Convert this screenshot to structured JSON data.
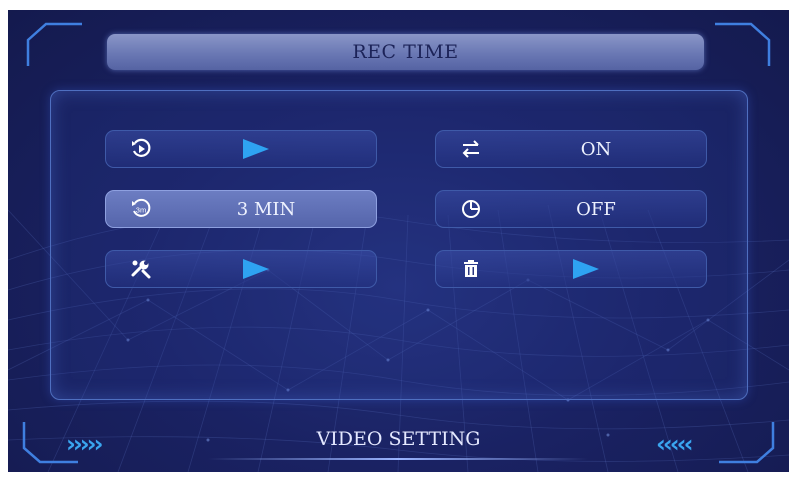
{
  "screen": {
    "title": "REC TIME",
    "footer": "VIDEO SETTING",
    "left_arrows": "›››››",
    "right_arrows": "‹‹‹‹‹"
  },
  "menu": {
    "playback": {
      "icon": "playback-icon",
      "value": ""
    },
    "loop": {
      "icon": "loop-arrows-icon",
      "value": "ON"
    },
    "rec_time": {
      "icon": "rec-time-icon",
      "value": "3 MIN",
      "selected": true
    },
    "timer": {
      "icon": "clock-icon",
      "value": "OFF"
    },
    "tools": {
      "icon": "wrench-icon",
      "value": ""
    },
    "delete": {
      "icon": "trash-icon",
      "value": ""
    }
  },
  "colors": {
    "accent": "#2ea3f2",
    "background": "#1a2263",
    "title_bar": "#7582bd",
    "text": "#eef2ff"
  }
}
